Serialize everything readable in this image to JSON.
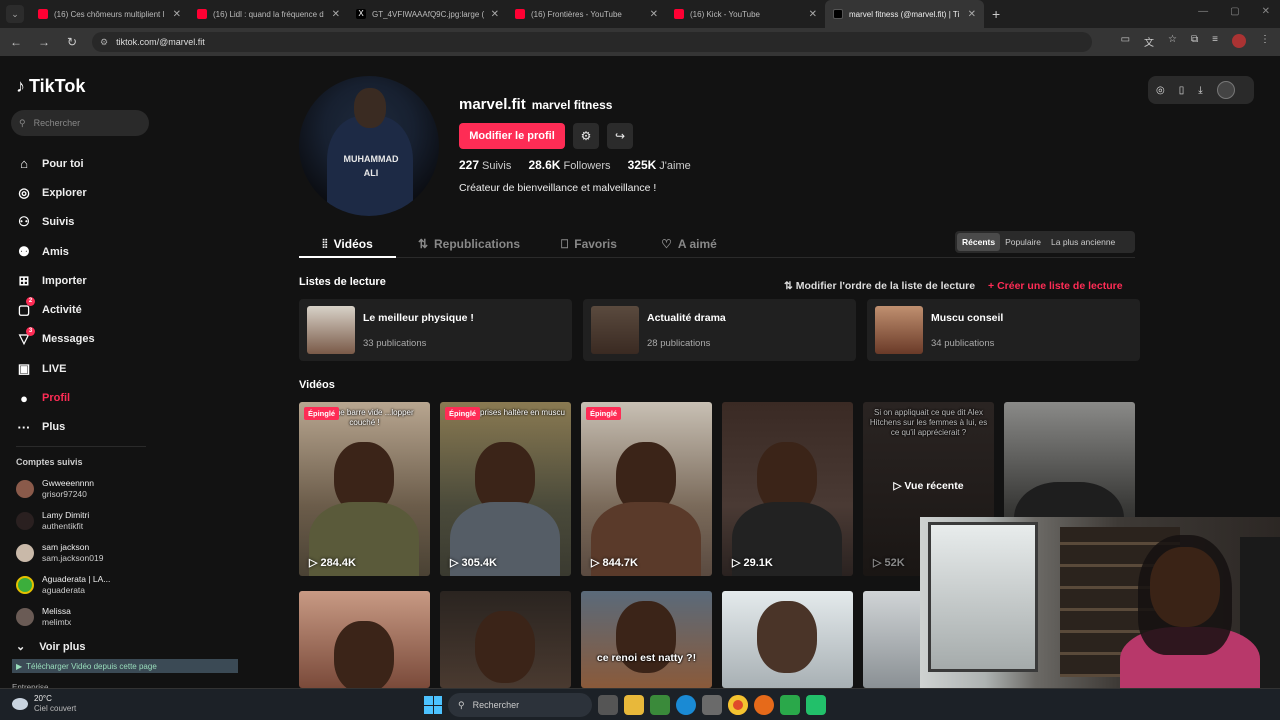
{
  "browser": {
    "tabs": [
      {
        "label": "(16) Ces chômeurs multiplient l",
        "icon": "youtube-icon",
        "color": "#ff0033"
      },
      {
        "label": "(16) Lidl : quand la fréquence d",
        "icon": "youtube-icon",
        "color": "#ff0033"
      },
      {
        "label": "GT_4VFIWAAAfQ9C.jpg:large (",
        "icon": "x-icon",
        "color": "#000000"
      },
      {
        "label": "(16) Frontières - YouTube",
        "icon": "youtube-icon",
        "color": "#ff0033"
      },
      {
        "label": "(16) Kick - YouTube",
        "icon": "youtube-icon",
        "color": "#ff0033"
      },
      {
        "label": "marvel fitness (@marvel.fit) | Ti",
        "icon": "tiktok-icon",
        "color": "#000000",
        "active": true
      }
    ],
    "url": "tiktok.com/@marvel.fit"
  },
  "sidebar": {
    "logo": "TikTok",
    "search_placeholder": "Rechercher",
    "nav": [
      {
        "label": "Pour toi",
        "icon": "home-icon"
      },
      {
        "label": "Explorer",
        "icon": "compass-icon"
      },
      {
        "label": "Suivis",
        "icon": "following-icon"
      },
      {
        "label": "Amis",
        "icon": "friends-icon"
      },
      {
        "label": "Importer",
        "icon": "upload-icon"
      },
      {
        "label": "Activité",
        "icon": "activity-icon",
        "badge": "2"
      },
      {
        "label": "Messages",
        "icon": "messages-icon",
        "badge": "3"
      },
      {
        "label": "LIVE",
        "icon": "live-icon"
      },
      {
        "label": "Profil",
        "icon": "profile-icon",
        "active": true
      },
      {
        "label": "Plus",
        "icon": "more-icon"
      }
    ],
    "following_title": "Comptes suivis",
    "following": [
      {
        "name": "Gwweeennnn",
        "handle": "grisor97240"
      },
      {
        "name": "Lamy Dimitri",
        "handle": "authentikfit"
      },
      {
        "name": "sam jackson",
        "handle": "sam.jackson019"
      },
      {
        "name": "Aguaderata | LA...",
        "handle": "aguaderata"
      },
      {
        "name": "Melissa",
        "handle": "melimtx"
      }
    ],
    "see_more": "Voir plus",
    "download_bar": "Télécharger Vidéo depuis cette page",
    "explore_label": "Entreprise"
  },
  "profile": {
    "username": "marvel.fit",
    "display_name": "marvel fitness",
    "edit_button": "Modifier le profil",
    "stats": {
      "following_count": "227",
      "following_label": "Suivis",
      "followers_count": "28.6K",
      "followers_label": "Followers",
      "likes_count": "325K",
      "likes_label": "J'aime"
    },
    "bio": "Créateur de bienveillance et malveillance !",
    "avatar_text": "MUHAMMAD ALI"
  },
  "tabs": [
    {
      "label": "Vidéos",
      "icon": "grid-icon",
      "active": true
    },
    {
      "label": "Republications",
      "icon": "repost-icon"
    },
    {
      "label": "Favoris",
      "icon": "bookmark-icon"
    },
    {
      "label": "A aimé",
      "icon": "heart-icon"
    }
  ],
  "sort": [
    "Récents",
    "Populaire",
    "La plus ancienne"
  ],
  "playlists": {
    "title": "Listes de lecture",
    "reorder": "Modifier l'ordre de la liste de lecture",
    "create": "Créer une liste de lecture",
    "items": [
      {
        "title": "Le meilleur physique !",
        "count": "33 publications"
      },
      {
        "title": "Actualité drama",
        "count": "28 publications"
      },
      {
        "title": "Muscu conseil",
        "count": "34 publications"
      }
    ]
  },
  "videos": {
    "title": "Vidéos",
    "pinned_label": "Épinglé",
    "recent_label": "Vue récente",
    "row1": [
      {
        "views": "284.4K",
        "caption": "...er une barre vide ...lopper couché !",
        "pinned": true
      },
      {
        "views": "305.4K",
        "caption": "prises haltère en muscu",
        "pinned": true
      },
      {
        "views": "844.7K",
        "caption": "",
        "pinned": true
      },
      {
        "views": "29.1K",
        "caption": ""
      },
      {
        "views": "52K",
        "caption": "Si on appliquait ce que dit Alex Hitchens sur les femmes à lui, es ce qu'il apprécierait ?"
      },
      {
        "views": "",
        "caption": ""
      }
    ],
    "row2": [
      {
        "caption": ""
      },
      {
        "caption": ""
      },
      {
        "caption": "ce renoi est natty ?!"
      },
      {
        "caption": ""
      },
      {
        "caption": ""
      }
    ]
  },
  "taskbar": {
    "weather_temp": "20°C",
    "weather_desc": "Ciel couvert",
    "search": "Rechercher"
  },
  "colors": {
    "accent": "#fe2c55",
    "background": "#121212"
  }
}
